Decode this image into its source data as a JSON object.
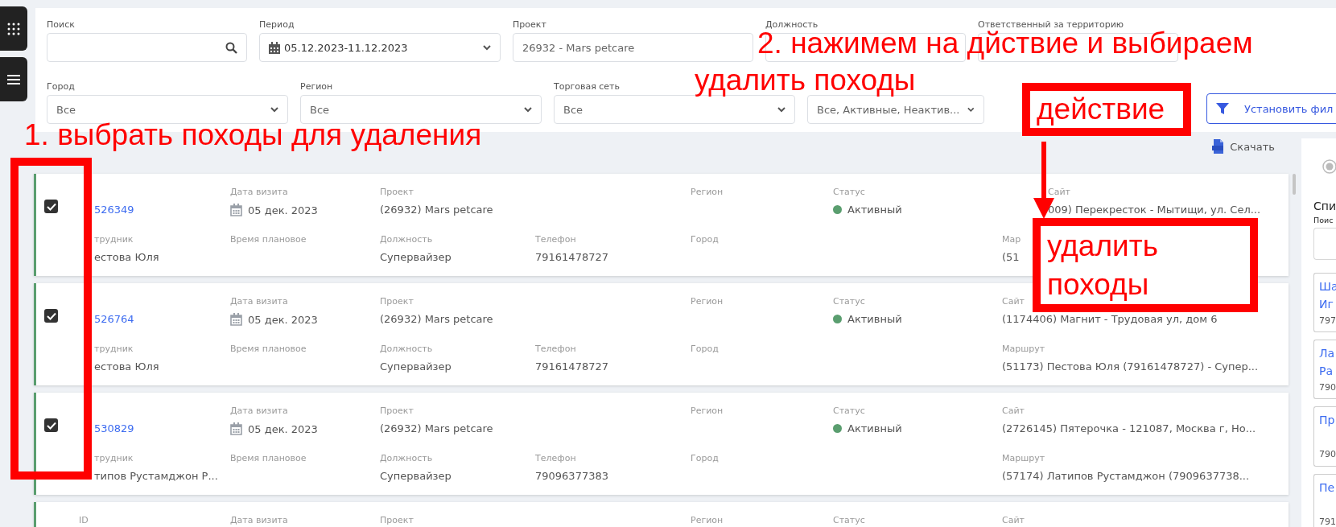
{
  "filters_row_1": [
    {
      "kind": "search",
      "label": "Поиск"
    },
    {
      "kind": "date",
      "label": "Период",
      "value": "05.12.2023-11.12.2023"
    },
    {
      "kind": "text",
      "label": "Проект",
      "value": "26932 - Mars petcare"
    },
    {
      "kind": "covered",
      "label": "Должность"
    },
    {
      "kind": "covered",
      "label": "Ответственный за территорию"
    }
  ],
  "filters_row_2": [
    {
      "kind": "select",
      "label": "Город",
      "value": "Все"
    },
    {
      "kind": "select",
      "label": "Регион",
      "value": "Все"
    },
    {
      "kind": "select",
      "label": "Торговая сеть",
      "value": "Все"
    },
    {
      "kind": "select",
      "value": "Все, Активные, Неактив..."
    }
  ],
  "apply_button": "Установить фил",
  "download_button": "Скачать",
  "visits": [
    {
      "checked": true,
      "top": [
        {
          "kind": "link",
          "value": "526349",
          "covered": true
        },
        {
          "kind": "date",
          "label": "Дата визита",
          "value": "05 дек. 2023"
        },
        {
          "kind": "text",
          "label": "Проект",
          "value": "(26932) Mars petcare"
        },
        {
          "kind": "blank"
        },
        {
          "kind": "text",
          "label": "Регион"
        },
        {
          "kind": "status",
          "label": "Статус",
          "value": "Активный",
          "color": "#5a9e6f"
        },
        {
          "kind": "text",
          "label": "Сайт",
          "value": "009) Перекресток - Мытищи, ул. Сел...",
          "covered": true
        }
      ],
      "bottom": [
        {
          "kind": "text",
          "label": "трудник",
          "value": "естова Юля",
          "covered": true
        },
        {
          "kind": "text",
          "label": "Время плановое"
        },
        {
          "kind": "text",
          "label": "Должность",
          "value": "Супервайзер"
        },
        {
          "kind": "text",
          "label": "Телефон",
          "value": "79161478727"
        },
        {
          "kind": "text",
          "label": "Город"
        },
        {
          "kind": "blank"
        },
        {
          "kind": "text",
          "label": "Мар",
          "value": "(51"
        }
      ]
    },
    {
      "checked": true,
      "top": [
        {
          "kind": "link",
          "value": "526764",
          "covered": true
        },
        {
          "kind": "date",
          "label": "Дата визита",
          "value": "05 дек. 2023"
        },
        {
          "kind": "text",
          "label": "Проект",
          "value": "(26932) Mars petcare"
        },
        {
          "kind": "blank"
        },
        {
          "kind": "text",
          "label": "Регион"
        },
        {
          "kind": "status",
          "label": "Статус",
          "value": "Активный",
          "color": "#5a9e6f"
        },
        {
          "kind": "text",
          "label": "Сайт",
          "value": "(1174406) Магнит - Трудовая ул, дом 6"
        }
      ],
      "bottom": [
        {
          "kind": "text",
          "label": "трудник",
          "value": "естова Юля",
          "covered": true
        },
        {
          "kind": "text",
          "label": "Время плановое"
        },
        {
          "kind": "text",
          "label": "Должность",
          "value": "Супервайзер"
        },
        {
          "kind": "text",
          "label": "Телефон",
          "value": "79161478727"
        },
        {
          "kind": "text",
          "label": "Город"
        },
        {
          "kind": "blank"
        },
        {
          "kind": "text",
          "label": "Маршрут",
          "value": "(51173) Пестова Юля (79161478727) - Супер..."
        }
      ]
    },
    {
      "checked": true,
      "top": [
        {
          "kind": "link",
          "value": "530829",
          "covered": true
        },
        {
          "kind": "date",
          "label": "Дата визита",
          "value": "05 дек. 2023"
        },
        {
          "kind": "text",
          "label": "Проект",
          "value": "(26932) Mars petcare"
        },
        {
          "kind": "blank"
        },
        {
          "kind": "text",
          "label": "Регион"
        },
        {
          "kind": "status",
          "label": "Статус",
          "value": "Активный",
          "color": "#5a9e6f"
        },
        {
          "kind": "text",
          "label": "Сайт",
          "value": "(2726145) Пятерочка - 121087, Москва г, Но..."
        }
      ],
      "bottom": [
        {
          "kind": "text",
          "label": "трудник",
          "value": "типов Рустамджон Р...",
          "covered": true
        },
        {
          "kind": "text",
          "label": "Время плановое"
        },
        {
          "kind": "text",
          "label": "Должность",
          "value": "Супервайзер"
        },
        {
          "kind": "text",
          "label": "Телефон",
          "value": "79096377383"
        },
        {
          "kind": "text",
          "label": "Город"
        },
        {
          "kind": "blank"
        },
        {
          "kind": "text",
          "label": "Маршрут",
          "value": "(57174) Латипов Рустамджон (7909637738..."
        }
      ]
    },
    {
      "top": [
        {
          "kind": "link",
          "label": "ID"
        },
        {
          "kind": "date",
          "label": "Дата визита"
        },
        {
          "kind": "text",
          "label": "Проект"
        },
        {
          "kind": "blank"
        },
        {
          "kind": "text",
          "label": "Регион"
        },
        {
          "kind": "status",
          "label": "Статус"
        },
        {
          "kind": "text",
          "label": "Сайт"
        }
      ]
    }
  ],
  "side_panel": {
    "title": "Спи",
    "search_label": "Поис",
    "cards": [
      {
        "name_lines": [
          "Ша",
          "Иг"
        ],
        "phone": "797"
      },
      {
        "name_lines": [
          "Ла",
          "Ра"
        ],
        "phone": "790"
      },
      {
        "name_lines": [
          "Пр"
        ],
        "phone": "790"
      },
      {
        "name_lines": [
          "Пе"
        ],
        "phone": "791"
      }
    ]
  },
  "annotations": [
    {
      "kind": "note",
      "text": "1. выбрать походы для удаления"
    },
    {
      "kind": "frame"
    },
    {
      "kind": "note",
      "text": "2. нажимем на дйствие и выбираем"
    },
    {
      "kind": "note",
      "text": "удалить походы"
    },
    {
      "kind": "labeled_frame",
      "text": "действие"
    },
    {
      "kind": "arrow"
    },
    {
      "kind": "labeled_frame",
      "text": "удалить походы"
    }
  ]
}
